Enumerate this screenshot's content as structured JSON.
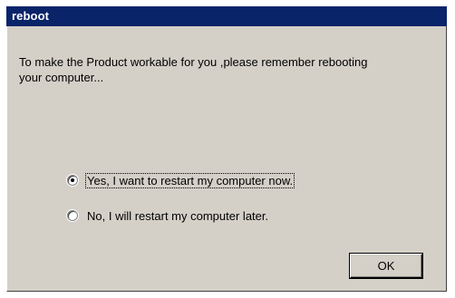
{
  "window": {
    "title": "reboot"
  },
  "message": "To make the Product workable for you ,please remember rebooting\nyour computer...",
  "options": [
    {
      "label": "Yes, I want to restart my computer now.",
      "selected": true
    },
    {
      "label": "No, I will restart my computer later.",
      "selected": false
    }
  ],
  "buttons": {
    "ok_label": "OK"
  },
  "colors": {
    "titlebar": "#0a246a",
    "dialog_face": "#d4d0c8"
  }
}
